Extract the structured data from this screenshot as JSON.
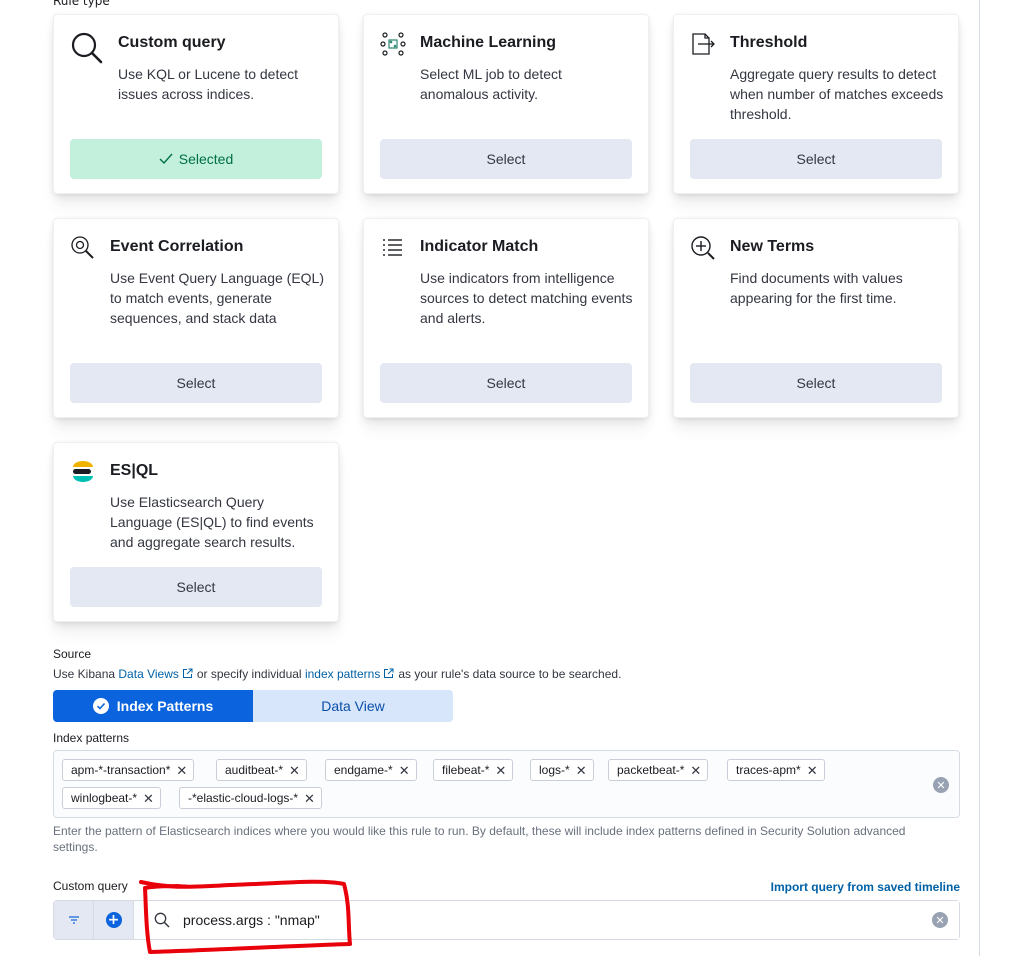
{
  "rule_type": {
    "label": "Rule type",
    "cards": [
      {
        "title": "Custom query",
        "description": "Use KQL or Lucene to detect issues across indices.",
        "button": "Selected",
        "selected": true,
        "icon": "search-icon"
      },
      {
        "title": "Machine Learning",
        "description": "Select ML job to detect anomalous activity.",
        "button": "Select",
        "selected": false,
        "icon": "machine-learning-icon"
      },
      {
        "title": "Threshold",
        "description": "Aggregate query results to detect when number of matches exceeds threshold.",
        "button": "Select",
        "selected": false,
        "icon": "threshold-icon"
      },
      {
        "title": "Event Correlation",
        "description": "Use Event Query Language (EQL) to match events, generate sequences, and stack data",
        "button": "Select",
        "selected": false,
        "icon": "event-correlation-icon"
      },
      {
        "title": "Indicator Match",
        "description": "Use indicators from intelligence sources to detect matching events and alerts.",
        "button": "Select",
        "selected": false,
        "icon": "list-icon"
      },
      {
        "title": "New Terms",
        "description": "Find documents with values appearing for the first time.",
        "button": "Select",
        "selected": false,
        "icon": "magnify-plus-icon"
      },
      {
        "title": "ES|QL",
        "description": "Use Elasticsearch Query Language (ES|QL) to find events and aggregate search results.",
        "button": "Select",
        "selected": false,
        "icon": "esql-logo-icon"
      }
    ]
  },
  "source": {
    "title": "Source",
    "help_prefix": "Use Kibana",
    "data_views_link": "Data Views",
    "help_middle": "or specify individual",
    "index_patterns_link": "index patterns",
    "help_suffix": "as your rule's data source to be searched.",
    "toggle": {
      "index_patterns": "Index Patterns",
      "data_view": "Data View",
      "active": "index_patterns"
    }
  },
  "index_patterns": {
    "label": "Index patterns",
    "items": [
      "apm-*-transaction*",
      "auditbeat-*",
      "endgame-*",
      "filebeat-*",
      "logs-*",
      "packetbeat-*",
      "traces-apm*",
      "winlogbeat-*",
      "-*elastic-cloud-logs-*"
    ],
    "help": "Enter the pattern of Elasticsearch indices where you would like this rule to run. By default, these will include index patterns defined in Security Solution advanced settings."
  },
  "custom_query": {
    "label": "Custom query",
    "import_link": "Import query from saved timeline",
    "value": "process.args : \"nmap\""
  },
  "colors": {
    "primary": "#0b64dd",
    "selected_bg": "#c3f0dd",
    "selected_text": "#006f47",
    "button_bg": "#e3e8f2",
    "annotation": "#e8000b"
  }
}
